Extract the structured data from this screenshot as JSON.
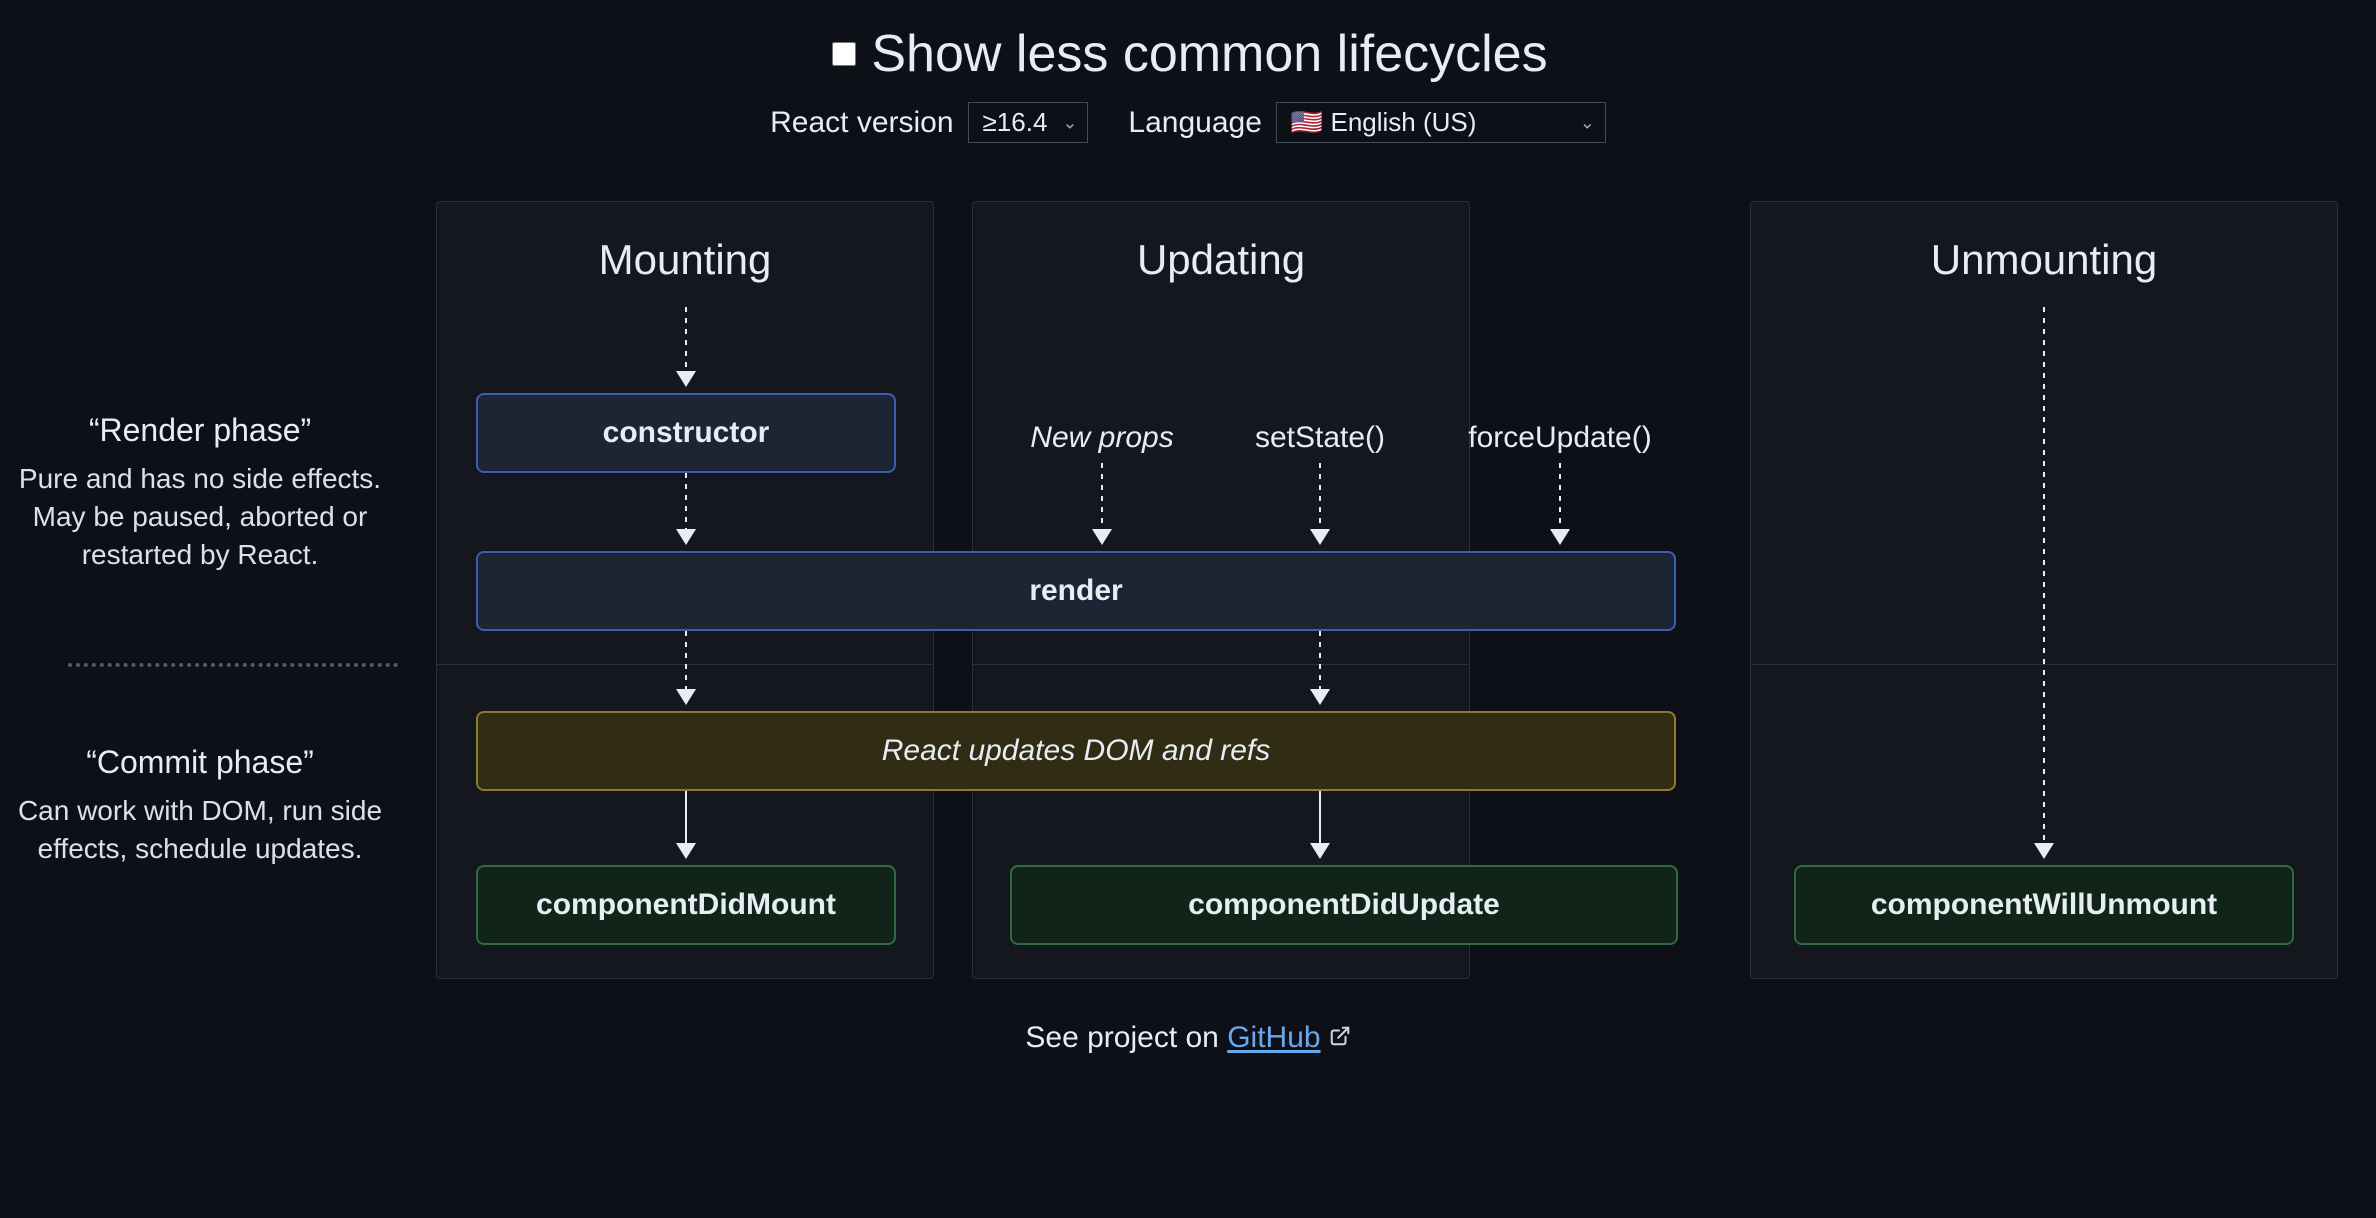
{
  "toggle": {
    "label": "Show less common lifecycles",
    "checked": false
  },
  "version_selector": {
    "label": "React version",
    "value": "≥16.4"
  },
  "language_selector": {
    "label": "Language",
    "value": "🇺🇸 English (US)"
  },
  "phases": {
    "render": {
      "title": "“Render phase”",
      "desc": "Pure and has no side effects. May be paused, aborted or restarted by React."
    },
    "commit": {
      "title": "“Commit phase”",
      "desc": "Can work with DOM, run side effects, schedule updates."
    }
  },
  "columns": {
    "mounting": {
      "title": "Mounting"
    },
    "updating": {
      "title": "Updating"
    },
    "unmounting": {
      "title": "Unmounting"
    }
  },
  "nodes": {
    "constructor": "constructor",
    "render": "render",
    "react_updates": "React updates DOM and refs",
    "did_mount": "componentDidMount",
    "did_update": "componentDidUpdate",
    "will_unmount": "componentWillUnmount"
  },
  "triggers": {
    "new_props": "New props",
    "set_state": "setState()",
    "force_update": "forceUpdate()"
  },
  "footer": {
    "prefix": "See project on ",
    "link_text": "GitHub"
  }
}
